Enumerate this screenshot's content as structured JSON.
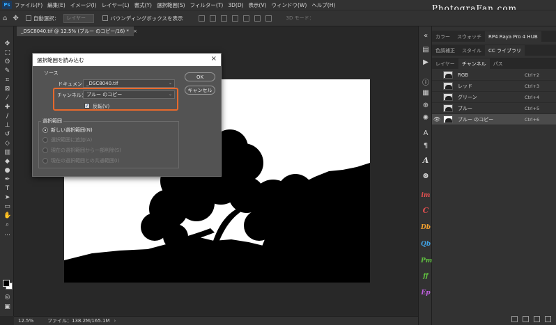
{
  "menu": {
    "items": [
      "ファイル(F)",
      "編集(E)",
      "イメージ(I)",
      "レイヤー(L)",
      "書式(Y)",
      "選択範囲(S)",
      "フィルター(T)",
      "3D(D)",
      "表示(V)",
      "ウィンドウ(W)",
      "ヘルプ(H)"
    ],
    "watermark": "PhotograFan.com"
  },
  "options": {
    "auto_select": "自動選択：",
    "auto_select_value": "レイヤー",
    "bounding_box": "バウンディングボックスを表示",
    "mode_3d": "3D モード："
  },
  "document": {
    "tab_title": "_DSC8040.tif @ 12.5% (ブルー のコピー/16) *",
    "tab_close": "×"
  },
  "status": {
    "zoom": "12.5%",
    "file_info": "ファイル：138.2M/165.1M",
    "arrow": "›"
  },
  "panels": {
    "row1_tabs": [
      "カラー",
      "スウォッチ",
      "RP4 Raya Pro 4 HUB"
    ],
    "row2_tabs": [
      "色調補正",
      "スタイル",
      "CC ライブラリ"
    ],
    "row3_tabs": [
      "レイヤー",
      "チャンネル",
      "パス"
    ],
    "channels": [
      {
        "name": "RGB",
        "shortcut": "Ctrl+2",
        "visible": false,
        "selected": false
      },
      {
        "name": "レッド",
        "shortcut": "Ctrl+3",
        "visible": false,
        "selected": false
      },
      {
        "name": "グリーン",
        "shortcut": "Ctrl+4",
        "visible": false,
        "selected": false
      },
      {
        "name": "ブルー",
        "shortcut": "Ctrl+5",
        "visible": false,
        "selected": false
      },
      {
        "name": "ブルー のコピー",
        "shortcut": "Ctrl+6",
        "visible": true,
        "selected": true
      }
    ]
  },
  "plugins": [
    "A",
    "im",
    "C",
    "Db",
    "Qb",
    "Pm",
    "ff",
    "Ep"
  ],
  "dialog": {
    "title": "選択範囲を読み込む",
    "close": "×",
    "source_label": "ソース",
    "document_label": "ドキュメント：",
    "document_value": "_DSC8040.tif",
    "channel_label": "チャンネル：",
    "channel_value": "ブルー のコピー",
    "invert_label": "反転(V)",
    "invert_checked": true,
    "operation_label": "選択範囲",
    "operations": [
      {
        "label": "新しい選択範囲(N)",
        "selected": true,
        "enabled": true
      },
      {
        "label": "選択範囲に追加(A)",
        "selected": false,
        "enabled": false
      },
      {
        "label": "現在の選択範囲から一部削除(S)",
        "selected": false,
        "enabled": false
      },
      {
        "label": "現在の選択範囲との共通範囲(I)",
        "selected": false,
        "enabled": false
      }
    ],
    "ok_label": "OK",
    "cancel_label": "キャンセル"
  },
  "colors": {
    "highlight": "#e8692c",
    "accent": "#31a8ff"
  }
}
